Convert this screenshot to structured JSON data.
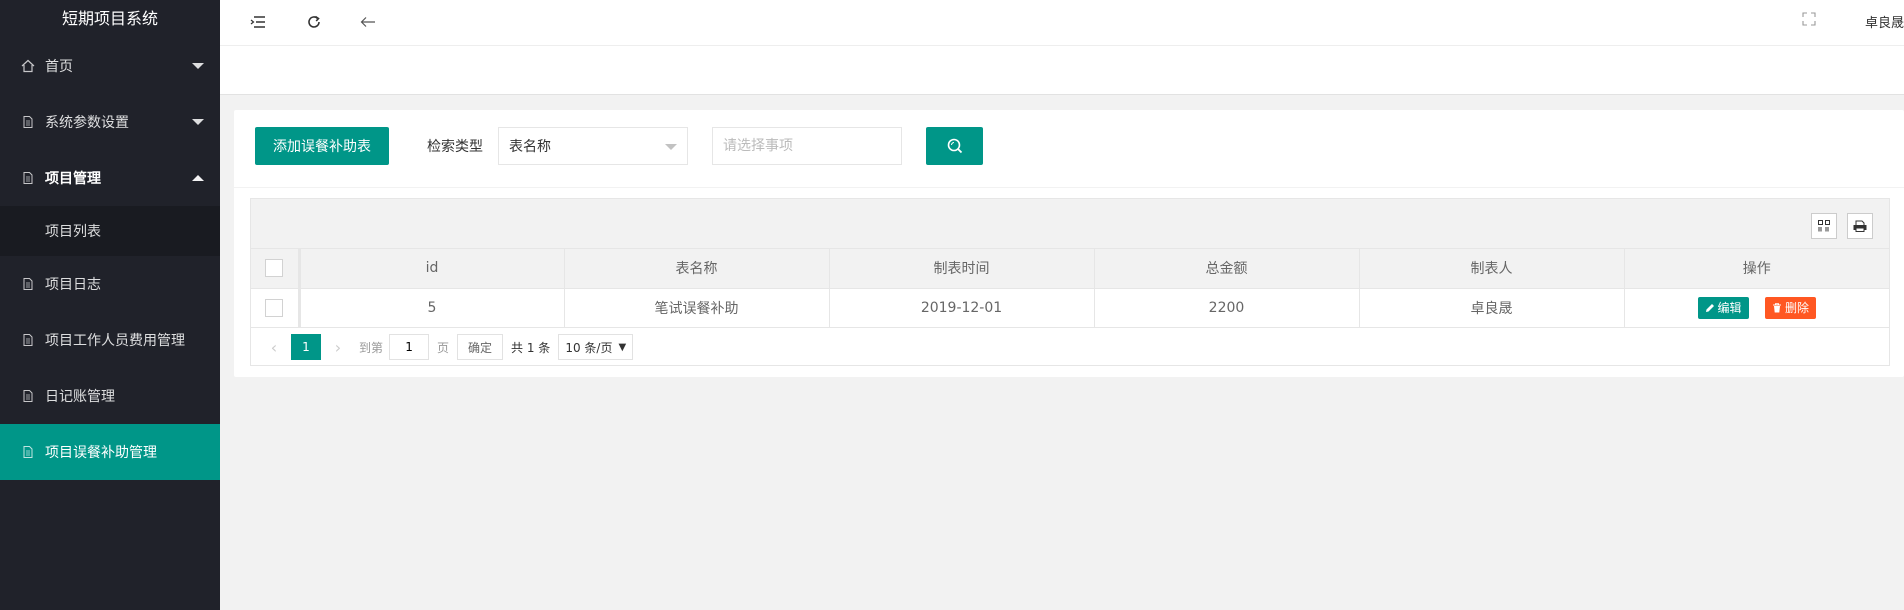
{
  "app": {
    "title": "短期项目系统",
    "username": "卓良晟"
  },
  "sidebar": {
    "items": [
      {
        "label": "首页"
      },
      {
        "label": "系统参数设置"
      },
      {
        "label": "项目管理"
      },
      {
        "label": "项目日志"
      },
      {
        "label": "项目工作人员费用管理"
      },
      {
        "label": "日记账管理"
      },
      {
        "label": "项目误餐补助管理"
      }
    ],
    "sub_item": {
      "label": "项目列表"
    }
  },
  "toolbar": {
    "add_button": "添加误餐补助表",
    "search_type_label": "检索类型",
    "search_type_value": "表名称",
    "search_placeholder": "请选择事项"
  },
  "table": {
    "columns": [
      "id",
      "表名称",
      "制表时间",
      "总金额",
      "制表人",
      "操作"
    ],
    "rows": [
      {
        "id": "5",
        "name": "笔试误餐补助",
        "date": "2019-12-01",
        "amount": "2200",
        "maker": "卓良晟"
      }
    ],
    "edit_label": "编辑",
    "delete_label": "删除"
  },
  "pager": {
    "current": "1",
    "goto_label": "到第",
    "goto_value": "1",
    "page_label": "页",
    "ok_label": "确定",
    "total": "共 1 条",
    "page_size": "10 条/页"
  },
  "colors": {
    "primary": "#009688",
    "danger": "#ff5722",
    "sidebar_bg": "#20222a"
  }
}
